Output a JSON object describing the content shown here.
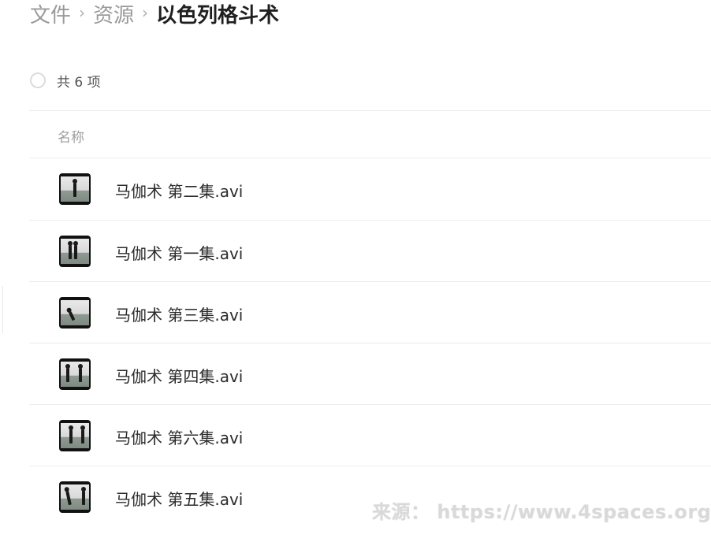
{
  "breadcrumb": {
    "items": [
      "文件",
      "资源"
    ],
    "current": "以色列格斗术",
    "separator": "›"
  },
  "summary": {
    "count_text": "共 6 项"
  },
  "list": {
    "column_name": "名称",
    "files": [
      {
        "name": "马伽术 第二集.avi",
        "icon": "video-thumbnail-icon"
      },
      {
        "name": "马伽术 第一集.avi",
        "icon": "video-thumbnail-icon"
      },
      {
        "name": "马伽术 第三集.avi",
        "icon": "video-thumbnail-icon"
      },
      {
        "name": "马伽术 第四集.avi",
        "icon": "video-thumbnail-icon"
      },
      {
        "name": "马伽术 第六集.avi",
        "icon": "video-thumbnail-icon"
      },
      {
        "name": "马伽术 第五集.avi",
        "icon": "video-thumbnail-icon"
      }
    ]
  },
  "watermark": {
    "text": "来源： https://www.4spaces.org/"
  },
  "colors": {
    "divider": "#ececec",
    "muted_text": "#9e9e9e",
    "title_text": "#1f1f1f"
  }
}
